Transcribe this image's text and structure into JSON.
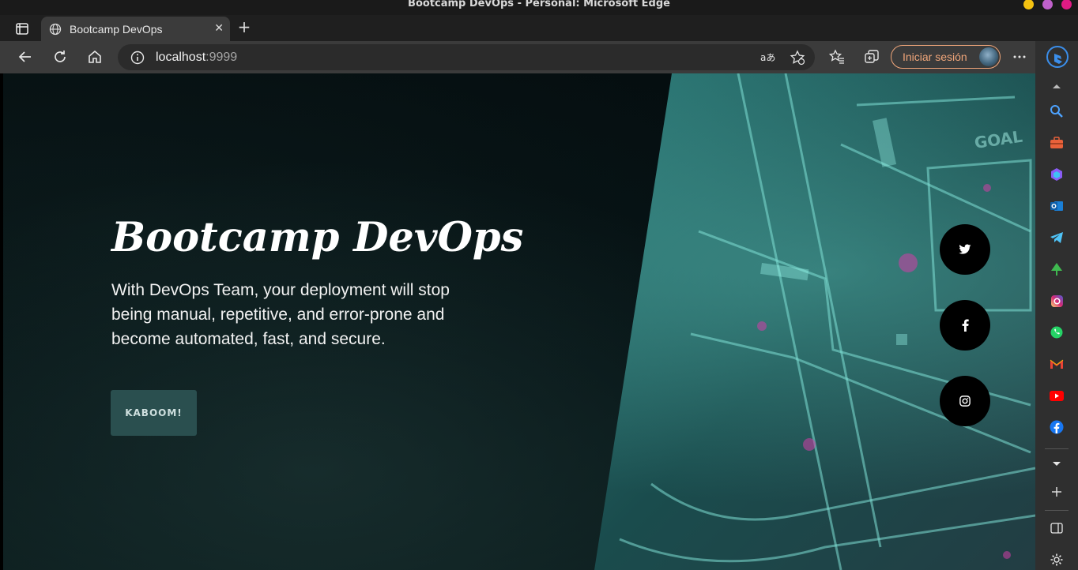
{
  "window": {
    "title": "Bootcamp DevOps - Personal: Microsoft Edge",
    "controls": [
      {
        "name": "minimize",
        "color": "#f5c211"
      },
      {
        "name": "maximize",
        "color": "#c061cb"
      },
      {
        "name": "close",
        "color": "#e01b84"
      }
    ]
  },
  "tabs": [
    {
      "title": "Bootcamp DevOps",
      "icon": "globe-icon",
      "active": true
    }
  ],
  "toolbar": {
    "url_host": "localhost",
    "url_port": ":9999",
    "sign_in_label": "Iniciar sesión",
    "sign_in_color": "#f0a67a"
  },
  "page": {
    "title": "Bootcamp DevOps",
    "description": "With DevOps Team, your deployment will stop being manual, repetitive, and error-prone and become automated, fast, and secure.",
    "button_label": "KABOOM!",
    "accent_color": "#2a4f4f",
    "background_overlay_text": "GOAL",
    "social_links": [
      "twitter-icon",
      "facebook-icon",
      "instagram-icon"
    ]
  },
  "sidebar": {
    "apps": [
      "search-icon",
      "tools-icon",
      "copilot-icon",
      "outlook-icon",
      "telegram-icon",
      "tree-icon",
      "instagram-icon",
      "whatsapp-icon",
      "gmail-icon",
      "youtube-icon",
      "facebook-icon"
    ]
  }
}
